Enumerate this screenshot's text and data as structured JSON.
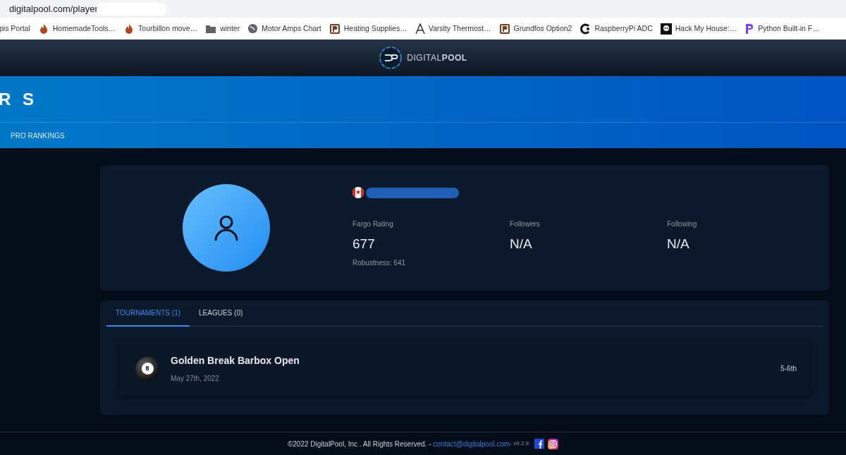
{
  "browser": {
    "url": "digitalpool.com/player",
    "url_redacted": true,
    "bookmarks": [
      {
        "label": "pis Portal",
        "kind": "plain"
      },
      {
        "label": "HomemadeTools…",
        "kind": "flame"
      },
      {
        "label": "Tourbillon move…",
        "kind": "flame"
      },
      {
        "label": "winter",
        "kind": "folder"
      },
      {
        "label": "Motor Amps Chart",
        "kind": "globe"
      },
      {
        "label": "Heating Supplies…",
        "kind": "p"
      },
      {
        "label": "Varsity Thermost…",
        "kind": "a"
      },
      {
        "label": "Grundfos Option2",
        "kind": "p"
      },
      {
        "label": "RaspberryPi ADC",
        "kind": "c"
      },
      {
        "label": "Hack My House:…",
        "kind": "skull"
      },
      {
        "label": "Python Built-in F…",
        "kind": "py"
      }
    ]
  },
  "header": {
    "logo_text": "DIGITAL**POOL**"
  },
  "banner": {
    "title": "R S",
    "nav": [
      "PRO RANKINGS"
    ]
  },
  "profile": {
    "name_redacted": true,
    "stats": [
      {
        "label": "Fargo Rating",
        "value": "677",
        "sub": "Robustness: 641"
      },
      {
        "label": "Followers",
        "value": "N/A"
      },
      {
        "label": "Following",
        "value": "N/A"
      }
    ]
  },
  "tabs": [
    {
      "label": "TOURNAMENTS (1)",
      "selected": true
    },
    {
      "label": "LEAGUES (0)",
      "selected": false
    }
  ],
  "results": [
    {
      "title": "Golden Break Barbox Open",
      "date": "May 27th, 2022",
      "place": "5-6th",
      "ball": "8"
    }
  ],
  "footer": {
    "text": "©2022 DigitalPool, Inc . All Rights Reserved. - ",
    "email": "contact@digitalpool.com",
    "version": " - v0.2.9"
  }
}
